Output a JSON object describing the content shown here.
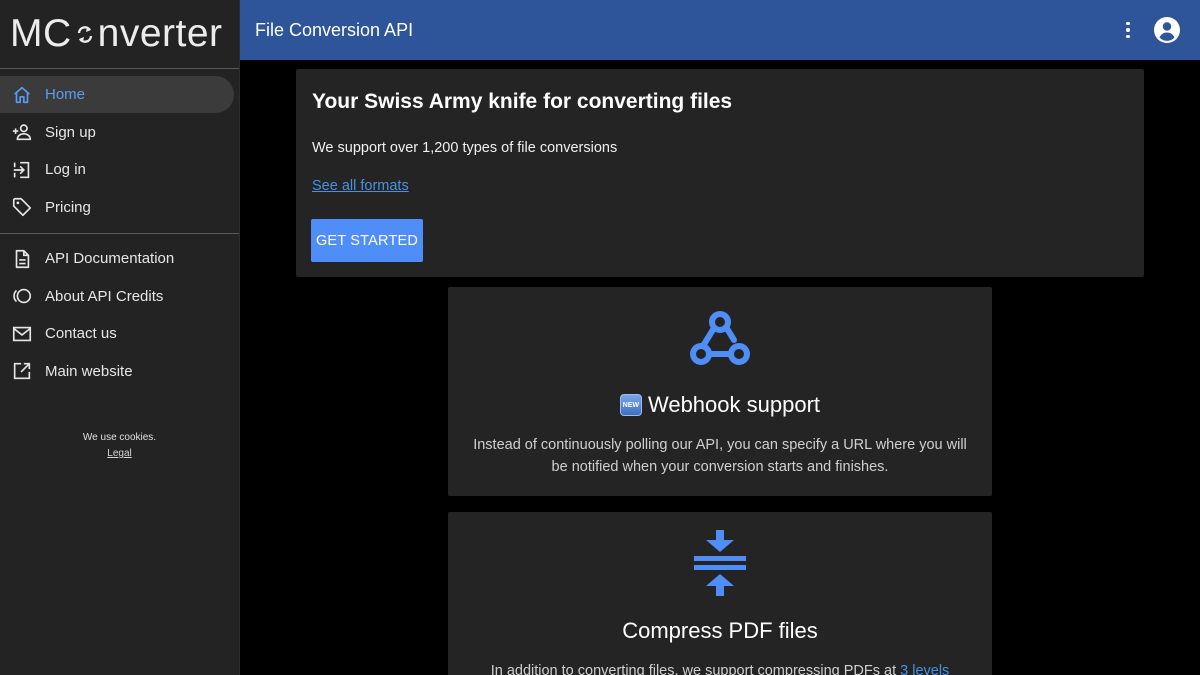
{
  "sidebar": {
    "logo": {
      "left": "MC",
      "right": "nverter"
    },
    "items_primary": [
      {
        "label": "Home",
        "icon": "home-icon",
        "active": true
      },
      {
        "label": "Sign up",
        "icon": "person-add-icon"
      },
      {
        "label": "Log in",
        "icon": "login-icon"
      },
      {
        "label": "Pricing",
        "icon": "tag-icon"
      }
    ],
    "items_secondary": [
      {
        "label": "API Documentation",
        "icon": "document-icon"
      },
      {
        "label": "About API Credits",
        "icon": "credits-icon"
      },
      {
        "label": "Contact us",
        "icon": "mail-icon"
      },
      {
        "label": "Main website",
        "icon": "external-link-icon"
      }
    ],
    "footer": {
      "cookies": "We use cookies.",
      "legal": "Legal"
    }
  },
  "topbar": {
    "title": "File Conversion API"
  },
  "hero": {
    "title": "Your Swiss Army knife for converting files",
    "subtitle": "We support over 1,200 types of file conversions",
    "link": "See all formats",
    "button": "GET STARTED"
  },
  "features": [
    {
      "badge": "NEW",
      "title": "Webhook support",
      "description": "Instead of continuously polling our API, you can specify a URL where you will be notified when your conversion starts and finishes.",
      "icon": "webhook-icon"
    },
    {
      "title": "Compress PDF files",
      "description_prefix": "In addition to converting files, we support compressing PDFs at ",
      "description_link": "3 levels",
      "icon": "compress-icon"
    }
  ],
  "colors": {
    "accent": "#4f8ef7",
    "topbar": "#2e5599",
    "sidebar": "#232323",
    "card": "#242424",
    "link": "#4a90e2"
  }
}
